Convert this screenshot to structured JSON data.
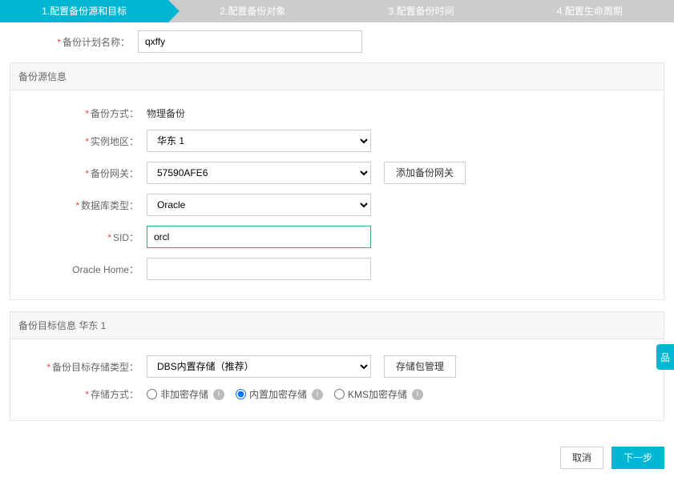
{
  "steps": {
    "s1": "1.配置备份源和目标",
    "s2": "2.配置备份对象",
    "s3": "3.配置备份时间",
    "s4": "4.配置生命周期"
  },
  "planName": {
    "label": "备份计划名称：",
    "value": "qxffy"
  },
  "sourcePanel": {
    "title": "备份源信息",
    "mode": {
      "label": "备份方式：",
      "value": "物理备份"
    },
    "region": {
      "label": "实例地区：",
      "value": "华东 1"
    },
    "gateway": {
      "label": "备份网关：",
      "value": "57590AFE6",
      "addBtn": "添加备份网关"
    },
    "dbType": {
      "label": "数据库类型：",
      "value": "Oracle"
    },
    "sid": {
      "label": "SID：",
      "value": "orcl"
    },
    "oracleHome": {
      "label": "Oracle Home：",
      "value": ""
    }
  },
  "targetPanel": {
    "title": "备份目标信息  华东 1",
    "storageType": {
      "label": "备份目标存储类型：",
      "value": "DBS内置存储（推荐）",
      "manageBtn": "存储包管理"
    },
    "storageMode": {
      "label": "存储方式：",
      "opt1": "非加密存储",
      "opt2": "内置加密存储",
      "opt3": "KMS加密存储"
    }
  },
  "footer": {
    "cancel": "取消",
    "next": "下一步"
  },
  "sideTag": "品"
}
